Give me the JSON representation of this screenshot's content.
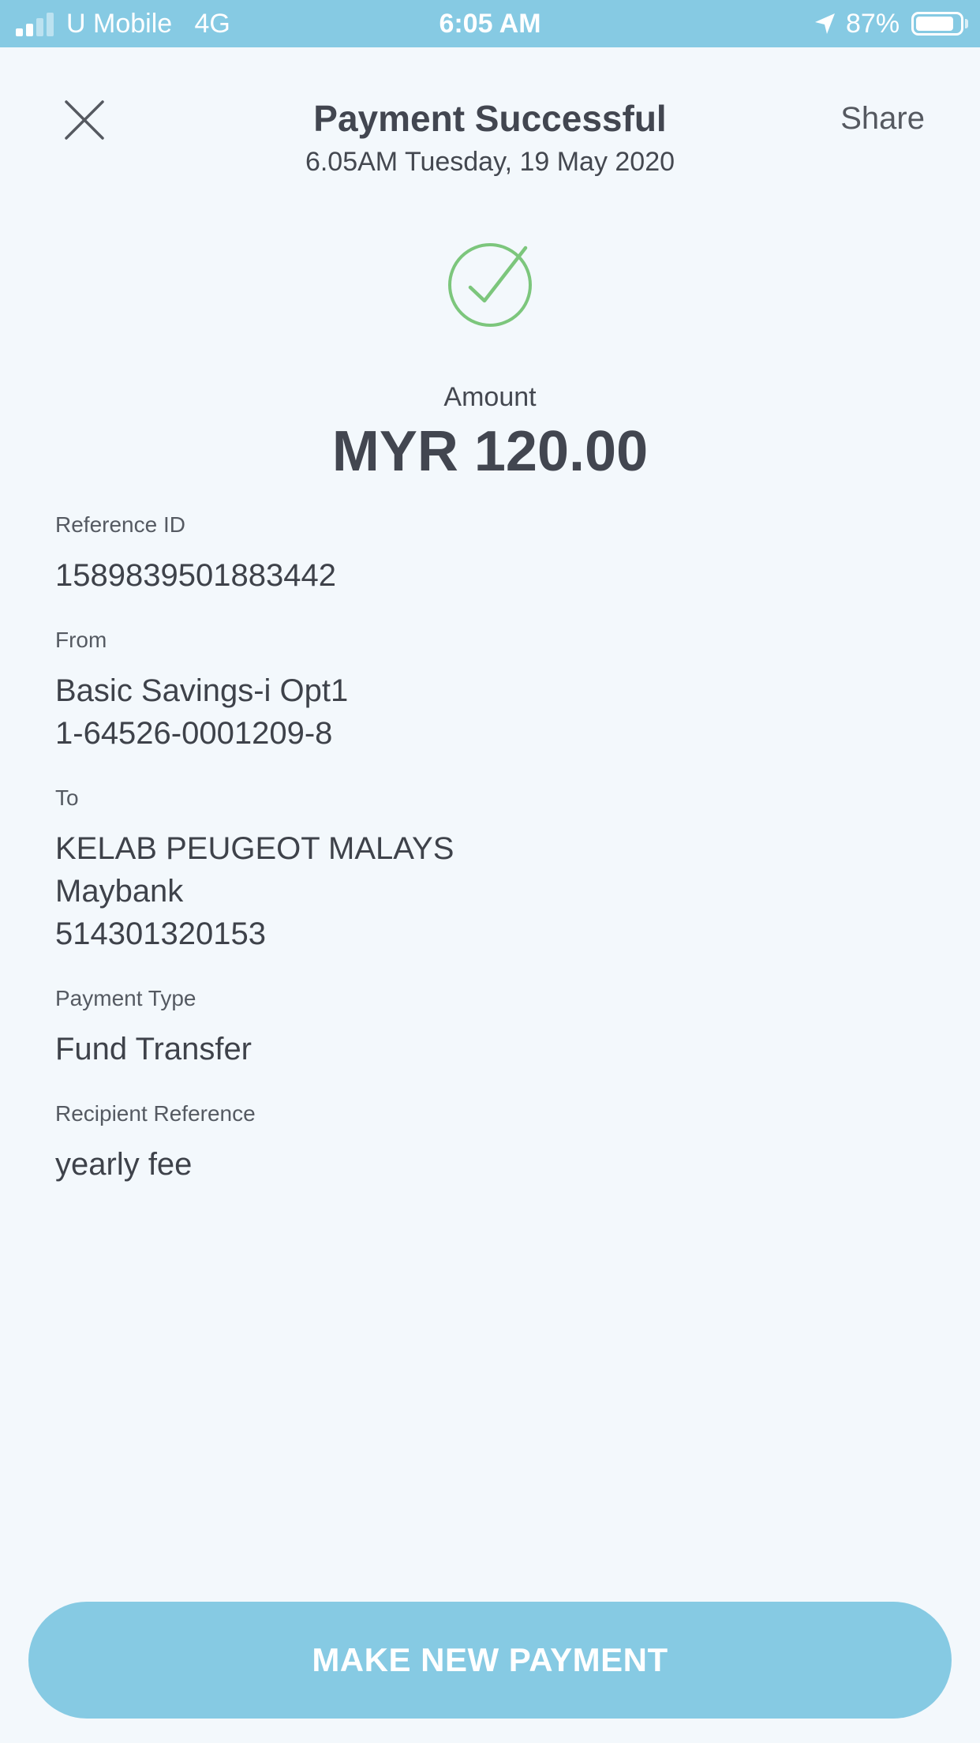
{
  "status_bar": {
    "carrier": "U Mobile   4G",
    "time": "6:05 AM",
    "battery_percent": "87%",
    "battery_level": 0.87,
    "signal_bars_filled": 2,
    "signal_bars_total": 4,
    "color": "#86cae3"
  },
  "header": {
    "title": "Payment Successful",
    "subtitle": "6.05AM Tuesday, 19 May 2020",
    "share_label": "Share",
    "close_icon": "close-icon"
  },
  "status_icon": "check-circle-icon",
  "success_color": "#7cc67c",
  "amount": {
    "label": "Amount",
    "value": "MYR 120.00"
  },
  "details": {
    "reference": {
      "label": "Reference ID",
      "value": "1589839501883442"
    },
    "from": {
      "label": "From",
      "lines": [
        "Basic Savings-i Opt1",
        "1-64526-0001209-8"
      ]
    },
    "to": {
      "label": "To",
      "lines": [
        "KELAB PEUGEOT MALAYS",
        "Maybank",
        "514301320153"
      ]
    },
    "payment_type": {
      "label": "Payment Type",
      "value": "Fund Transfer"
    },
    "recipient_reference": {
      "label": "Recipient Reference",
      "value": "yearly fee"
    }
  },
  "primary_button": {
    "label": "MAKE NEW PAYMENT",
    "color": "#86cae3"
  }
}
